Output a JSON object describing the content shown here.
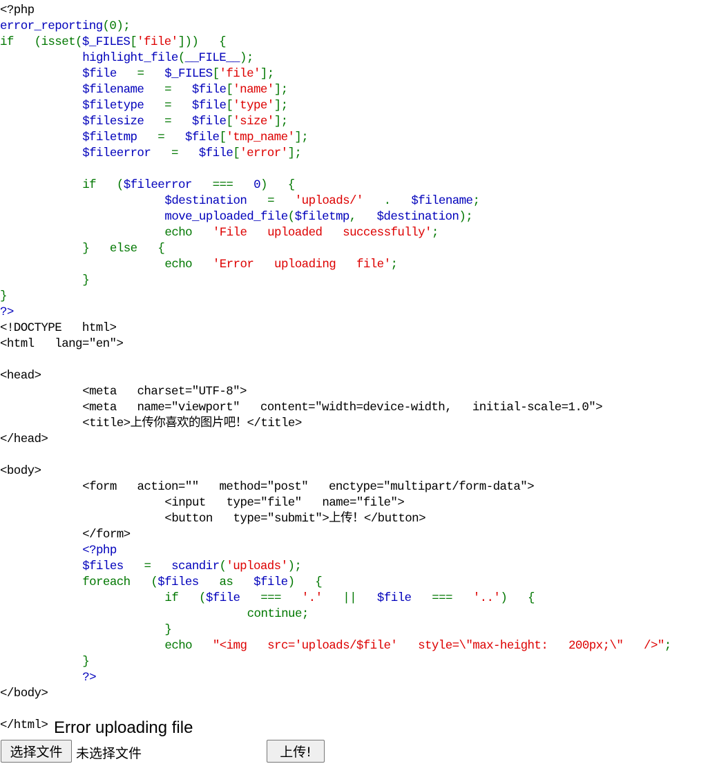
{
  "source_code": [
    [
      [
        "h",
        "<?php"
      ]
    ],
    [
      [
        "v",
        "error_reporting"
      ],
      [
        "k",
        "(0);"
      ]
    ],
    [
      [
        "k",
        "if  (isset("
      ],
      [
        "v",
        "$_FILES"
      ],
      [
        "k",
        "["
      ],
      [
        "s",
        "'file'"
      ],
      [
        "k",
        "]))  {"
      ]
    ],
    [
      [
        "v",
        "        highlight_file"
      ],
      [
        "k",
        "("
      ],
      [
        "v",
        "__FILE__"
      ],
      [
        "k",
        ");"
      ]
    ],
    [
      [
        "v",
        "        $file  "
      ],
      [
        "k",
        "=  "
      ],
      [
        "v",
        "$_FILES"
      ],
      [
        "k",
        "["
      ],
      [
        "s",
        "'file'"
      ],
      [
        "k",
        "];"
      ]
    ],
    [
      [
        "v",
        "        $filename  "
      ],
      [
        "k",
        "=  "
      ],
      [
        "v",
        "$file"
      ],
      [
        "k",
        "["
      ],
      [
        "s",
        "'name'"
      ],
      [
        "k",
        "];"
      ]
    ],
    [
      [
        "v",
        "        $filetype  "
      ],
      [
        "k",
        "=  "
      ],
      [
        "v",
        "$file"
      ],
      [
        "k",
        "["
      ],
      [
        "s",
        "'type'"
      ],
      [
        "k",
        "];"
      ]
    ],
    [
      [
        "v",
        "        $filesize  "
      ],
      [
        "k",
        "=  "
      ],
      [
        "v",
        "$file"
      ],
      [
        "k",
        "["
      ],
      [
        "s",
        "'size'"
      ],
      [
        "k",
        "];"
      ]
    ],
    [
      [
        "v",
        "        $filetmp  "
      ],
      [
        "k",
        "=  "
      ],
      [
        "v",
        "$file"
      ],
      [
        "k",
        "["
      ],
      [
        "s",
        "'tmp_name'"
      ],
      [
        "k",
        "];"
      ]
    ],
    [
      [
        "v",
        "        $fileerror  "
      ],
      [
        "k",
        "=  "
      ],
      [
        "v",
        "$file"
      ],
      [
        "k",
        "["
      ],
      [
        "s",
        "'error'"
      ],
      [
        "k",
        "];"
      ]
    ],
    [],
    [
      [
        "k",
        "        if  ("
      ],
      [
        "v",
        "$fileerror  "
      ],
      [
        "k",
        "===  "
      ],
      [
        "v",
        "0"
      ],
      [
        "k",
        ")  {"
      ]
    ],
    [
      [
        "v",
        "                $destination  "
      ],
      [
        "k",
        "=  "
      ],
      [
        "s",
        "'uploads/'  "
      ],
      [
        "k",
        ".  "
      ],
      [
        "v",
        "$filename"
      ],
      [
        "k",
        ";"
      ]
    ],
    [
      [
        "v",
        "                move_uploaded_file"
      ],
      [
        "k",
        "("
      ],
      [
        "v",
        "$filetmp"
      ],
      [
        "k",
        ",  "
      ],
      [
        "v",
        "$destination"
      ],
      [
        "k",
        ");"
      ]
    ],
    [
      [
        "k",
        "                echo  "
      ],
      [
        "s",
        "'File  uploaded  successfully'"
      ],
      [
        "k",
        ";"
      ]
    ],
    [
      [
        "k",
        "        }  else  {"
      ]
    ],
    [
      [
        "k",
        "                echo  "
      ],
      [
        "s",
        "'Error  uploading  file'"
      ],
      [
        "k",
        ";"
      ]
    ],
    [
      [
        "k",
        "        }"
      ]
    ],
    [
      [
        "k",
        "}"
      ]
    ],
    [
      [
        "v",
        "?>"
      ]
    ],
    [
      [
        "h",
        "<!DOCTYPE  html>"
      ]
    ],
    [
      [
        "h",
        "<html  lang=\"en\">"
      ]
    ],
    [],
    [
      [
        "h",
        "<head>"
      ]
    ],
    [
      [
        "h",
        "        <meta  charset=\"UTF-8\">"
      ]
    ],
    [
      [
        "h",
        "        <meta  name=\"viewport\"  content=\"width=device-width,  initial-scale=1.0\">"
      ]
    ],
    [
      [
        "h",
        "        <title>上传你喜欢的图片吧！</title>"
      ]
    ],
    [
      [
        "h",
        "</head>"
      ]
    ],
    [],
    [
      [
        "h",
        "<body>"
      ]
    ],
    [
      [
        "h",
        "        <form  action=\"\"  method=\"post\"  enctype=\"multipart/form-data\">"
      ]
    ],
    [
      [
        "h",
        "                <input  type=\"file\"  name=\"file\">"
      ]
    ],
    [
      [
        "h",
        "                <button  type=\"submit\">上传！</button>"
      ]
    ],
    [
      [
        "h",
        "        </form>"
      ]
    ],
    [
      [
        "v",
        "        <?php"
      ]
    ],
    [
      [
        "v",
        "        $files  "
      ],
      [
        "k",
        "=  "
      ],
      [
        "v",
        "scandir"
      ],
      [
        "k",
        "("
      ],
      [
        "s",
        "'uploads'"
      ],
      [
        "k",
        ");"
      ]
    ],
    [
      [
        "k",
        "        foreach  ("
      ],
      [
        "v",
        "$files  "
      ],
      [
        "k",
        "as  "
      ],
      [
        "v",
        "$file"
      ],
      [
        "k",
        ")  {"
      ]
    ],
    [
      [
        "k",
        "                if  ("
      ],
      [
        "v",
        "$file  "
      ],
      [
        "k",
        "===  "
      ],
      [
        "s",
        "'.'  "
      ],
      [
        "k",
        "||  "
      ],
      [
        "v",
        "$file  "
      ],
      [
        "k",
        "===  "
      ],
      [
        "s",
        "'..'"
      ],
      [
        "k",
        ")  {"
      ]
    ],
    [
      [
        "k",
        "                        continue;"
      ]
    ],
    [
      [
        "k",
        "                }"
      ]
    ],
    [
      [
        "k",
        "                echo  "
      ],
      [
        "s",
        "\"<img  src='uploads/$file'  style=\\\"max-height:  200px;\\\"  />\""
      ],
      [
        "k",
        ";"
      ]
    ],
    [
      [
        "k",
        "        }"
      ]
    ],
    [
      [
        "v",
        "        ?>"
      ]
    ],
    [
      [
        "h",
        "</body>"
      ]
    ],
    [],
    [
      [
        "h",
        "</html>"
      ]
    ]
  ],
  "output": {
    "message": "Error uploading file"
  },
  "form": {
    "file_button_label": "选择文件",
    "file_status": "未选择文件",
    "submit_label": "上传!"
  },
  "colors": {
    "keyword": "#007700",
    "variable": "#0000BB",
    "string": "#DD0000",
    "html": "#000000"
  }
}
